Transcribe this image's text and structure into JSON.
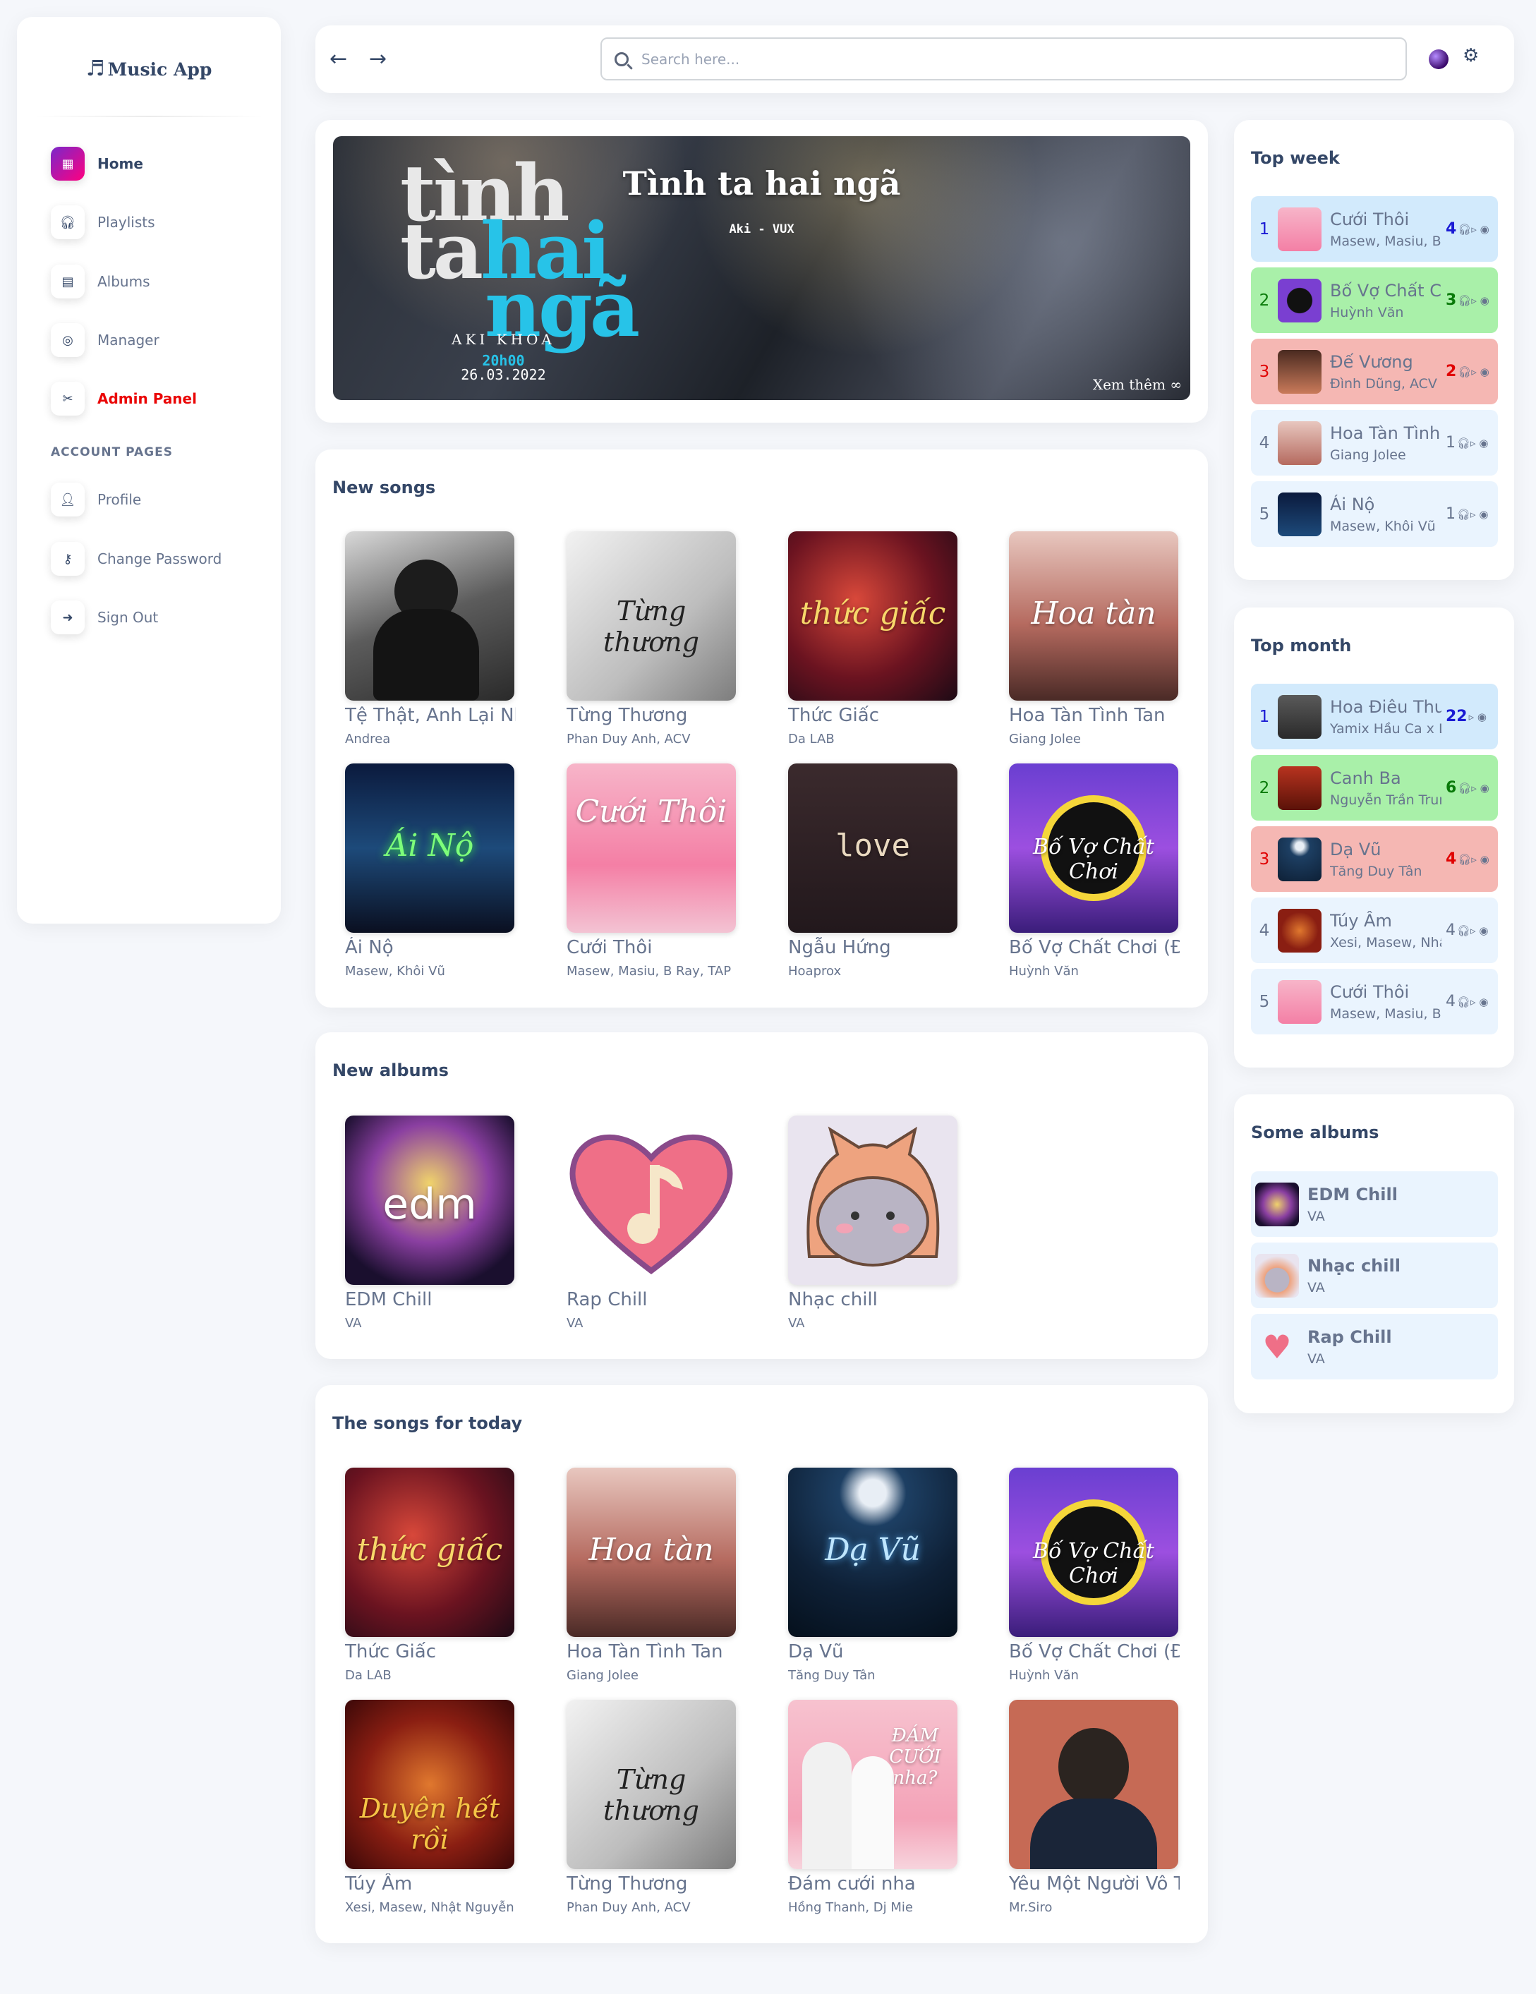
{
  "app": {
    "title": "Music App"
  },
  "sidebar": {
    "items": [
      {
        "label": "Home",
        "icon": "store-icon"
      },
      {
        "label": "Playlists",
        "icon": "headphones-icon"
      },
      {
        "label": "Albums",
        "icon": "album-icon"
      },
      {
        "label": "Manager",
        "icon": "manager-icon"
      },
      {
        "label": "Admin Panel",
        "icon": "tools-icon"
      }
    ],
    "account_label": "ACCOUNT PAGES",
    "account_items": [
      {
        "label": "Profile",
        "icon": "profile-icon"
      },
      {
        "label": "Change Password",
        "icon": "key-icon"
      },
      {
        "label": "Sign Out",
        "icon": "signout-icon"
      }
    ]
  },
  "topbar": {
    "search_placeholder": "Search here..."
  },
  "banner": {
    "title": "Tình ta hai ngã",
    "artist": "Aki - VUX",
    "big_text_1": "tình",
    "big_text_2": "ta",
    "big_text_3": "hai",
    "big_text_4": "ngã",
    "credit": "AKI KHOA",
    "time": "20h00",
    "date": "26.03.2022",
    "more": "Xem thêm ∞"
  },
  "new_songs": {
    "title": "New songs",
    "items": [
      {
        "name": "Tệ Thật, Anh Lại Nhớ Em",
        "artist": "Andrea"
      },
      {
        "name": "Từng Thương",
        "artist": "Phan Duy Anh, ACV",
        "cover_text": "Từng thương"
      },
      {
        "name": "Thức Giấc",
        "artist": "Da LAB",
        "cover_text": "thức giấc"
      },
      {
        "name": "Hoa Tàn Tình Tan",
        "artist": "Giang Jolee",
        "cover_text": "Hoa tàn"
      },
      {
        "name": "Ái Nộ",
        "artist": "Masew, Khôi Vũ",
        "cover_text": "Ái Nộ"
      },
      {
        "name": "Cưới Thôi",
        "artist": "Masew, Masiu, B Ray, TAP",
        "cover_text": "Cưới Thôi"
      },
      {
        "name": "Ngẫu Hứng",
        "artist": "Hoaprox",
        "cover_text": "love"
      },
      {
        "name": "Bố Vợ Chất Chơi (Đại Mèo Remix)",
        "artist": "Huỳnh Văn",
        "cover_text": "Bố Vợ Chất Chơi"
      }
    ]
  },
  "new_albums": {
    "title": "New albums",
    "items": [
      {
        "name": "EDM Chill",
        "artist": "VA",
        "cover_text": "edm"
      },
      {
        "name": "Rap Chill",
        "artist": "VA"
      },
      {
        "name": "Nhạc chill",
        "artist": "VA"
      }
    ]
  },
  "today": {
    "title": "The songs for today",
    "items": [
      {
        "name": "Thức Giấc",
        "artist": "Da LAB",
        "cover_text": "thức giấc"
      },
      {
        "name": "Hoa Tàn Tình Tan",
        "artist": "Giang Jolee",
        "cover_text": "Hoa tàn"
      },
      {
        "name": "Dạ Vũ",
        "artist": "Tăng Duy Tân",
        "cover_text": "Dạ Vũ"
      },
      {
        "name": "Bố Vợ Chất Chơi (Đại Mèo Remix)",
        "artist": "Huỳnh Văn",
        "cover_text": "Bố Vợ Chất Chơi"
      },
      {
        "name": "Túy Âm",
        "artist": "Xesi, Masew, Nhật Nguyễn",
        "cover_text": "Duyên hết rồi"
      },
      {
        "name": "Từng Thương",
        "artist": "Phan Duy Anh, ACV",
        "cover_text": "Từng thương"
      },
      {
        "name": "Đám cưới nha",
        "artist": "Hồng Thanh, Dj Mie",
        "cover_text": "ĐÁM CƯỚI nha?"
      },
      {
        "name": "Yêu Một Người Vô Tâm",
        "artist": "Mr.Siro"
      }
    ]
  },
  "top_week": {
    "title": "Top week",
    "items": [
      {
        "rank": "1",
        "name": "Cưới Thôi",
        "artist": "Masew, Masiu, B Ray, TAP",
        "count": "4"
      },
      {
        "rank": "2",
        "name": "Bố Vợ Chất Chơi",
        "artist": "Huỳnh Văn",
        "count": "3"
      },
      {
        "rank": "3",
        "name": "Đế Vương",
        "artist": "Đình Dũng, ACV",
        "count": "2"
      },
      {
        "rank": "4",
        "name": "Hoa Tàn Tình Tan",
        "artist": "Giang Jolee",
        "count": "1"
      },
      {
        "rank": "5",
        "name": "Ái Nộ",
        "artist": "Masew, Khôi Vũ",
        "count": "1"
      }
    ]
  },
  "top_month": {
    "title": "Top month",
    "items": [
      {
        "rank": "1",
        "name": "Hoa Điêu Thuyền",
        "artist": "Yamix Hầu Ca x Long Rex",
        "count": "22"
      },
      {
        "rank": "2",
        "name": "Canh Ba",
        "artist": "Nguyễn Trần Trung Quân",
        "count": "6"
      },
      {
        "rank": "3",
        "name": "Dạ Vũ",
        "artist": "Tăng Duy Tân",
        "count": "4"
      },
      {
        "rank": "4",
        "name": "Túy Âm",
        "artist": "Xesi, Masew, Nhật Nguyễn",
        "count": "4"
      },
      {
        "rank": "5",
        "name": "Cưới Thôi",
        "artist": "Masew, Masiu, B Ray, TAP",
        "count": "4"
      }
    ]
  },
  "some_albums": {
    "title": "Some albums",
    "items": [
      {
        "name": "EDM Chill",
        "artist": "VA"
      },
      {
        "name": "Nhạc chill",
        "artist": "VA"
      },
      {
        "name": "Rap Chill",
        "artist": "VA"
      }
    ]
  },
  "colors": {
    "rank1_bg": "#d2eafc",
    "rank1_fg": "#1a1ad4",
    "rank2_bg": "#a9f0a9",
    "rank2_fg": "#0a7a0a",
    "rank3_bg": "#f5b7b3",
    "rank3_fg": "#e00000",
    "rank_other_bg": "#eaf4fe",
    "accent": "#cb0c9f",
    "danger": "#ea0606"
  }
}
